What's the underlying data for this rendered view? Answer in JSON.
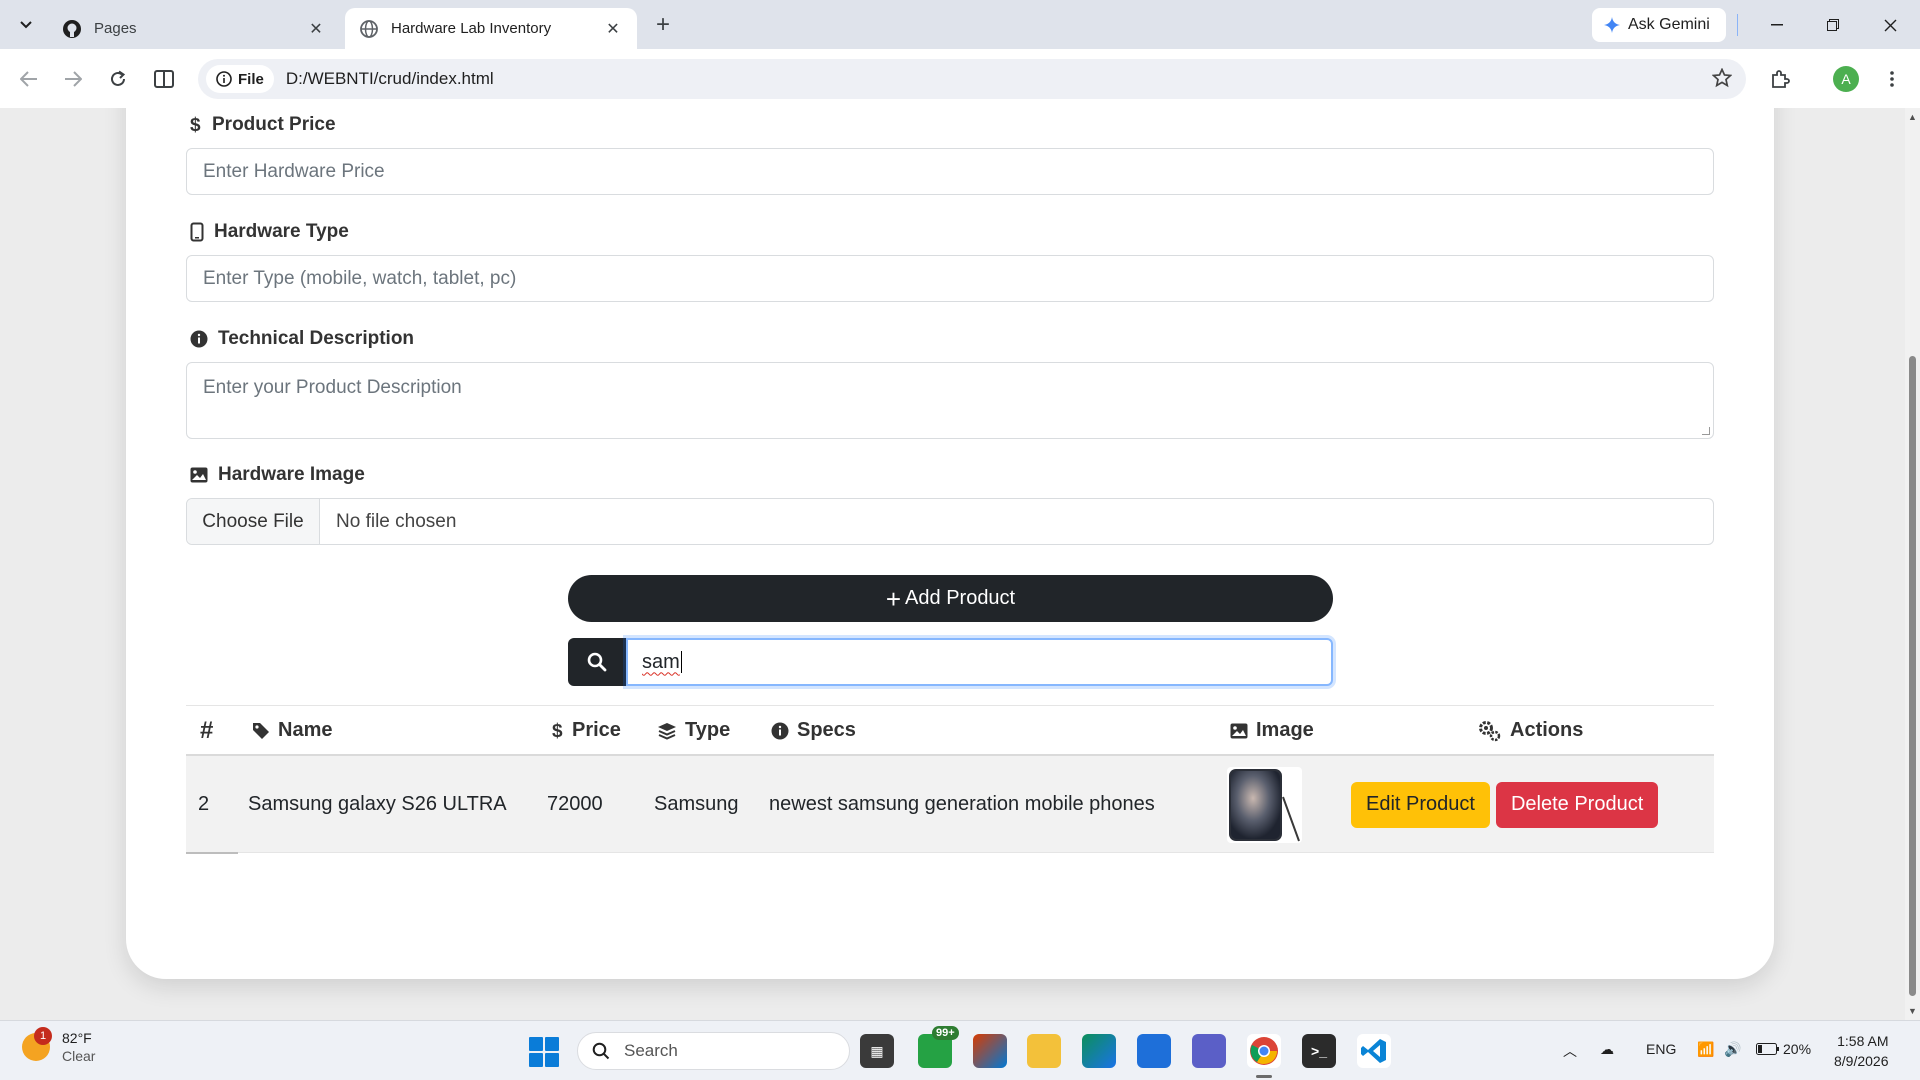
{
  "browser": {
    "tabs": [
      {
        "title": "Pages",
        "icon": "github-icon"
      },
      {
        "title": "Hardware Lab Inventory",
        "icon": "globe-icon"
      }
    ],
    "ask_gemini": "Ask Gemini",
    "site_info": "File",
    "url": "D:/WEBNTI/crud/index.html",
    "profile_initial": "A"
  },
  "form": {
    "price": {
      "label": "Product Price",
      "placeholder": "Enter Hardware Price"
    },
    "type": {
      "label": "Hardware Type",
      "placeholder": "Enter Type (mobile, watch, tablet, pc)"
    },
    "description": {
      "label": "Technical Description",
      "placeholder": "Enter your Product Description"
    },
    "image": {
      "label": "Hardware Image",
      "button": "Choose File",
      "status": "No file chosen"
    },
    "add_button": "Add Product"
  },
  "search": {
    "value": "sam"
  },
  "table": {
    "headers": {
      "index": "#",
      "name": "Name",
      "price": "Price",
      "type": "Type",
      "specs": "Specs",
      "image": "Image",
      "actions": "Actions"
    },
    "rows": [
      {
        "index": "2",
        "name": "Samsung galaxy S26 ULTRA",
        "price": "72000",
        "type": "Samsung",
        "specs": "newest samsung generation mobile phones",
        "edit": "Edit Product",
        "delete": "Delete Product"
      }
    ]
  },
  "taskbar": {
    "weather_temp": "82°F",
    "weather_cond": "Clear",
    "weather_badge": "1",
    "search_label": "Search",
    "whatsapp_badge": "99+",
    "language": "ENG",
    "battery": "20%",
    "time": "1:58 AM",
    "date": "8/9/2026"
  },
  "colors": {
    "primary_dark": "#212529",
    "warning": "#ffc107",
    "danger": "#dc3545",
    "focus": "#86b7fe"
  }
}
